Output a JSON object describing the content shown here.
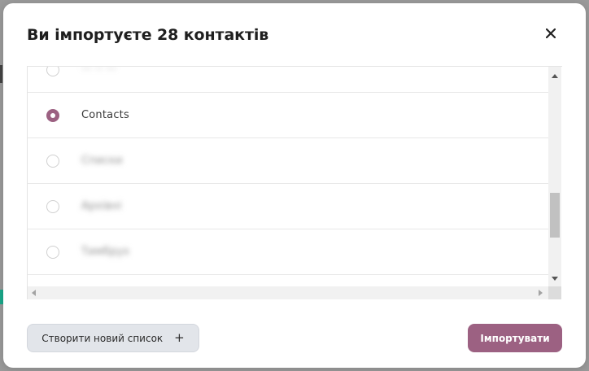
{
  "dialog": {
    "title": "Ви імпортуєте 28 контактів",
    "close_icon": "close-icon"
  },
  "lists": [
    {
      "label": "··· ·· ···",
      "selected": false,
      "blurred": true
    },
    {
      "label": "Contacts",
      "selected": true,
      "blurred": false
    },
    {
      "label": "Списки",
      "selected": false,
      "blurred": true
    },
    {
      "label": "Архівні",
      "selected": false,
      "blurred": true
    },
    {
      "label": "Тимбрух",
      "selected": false,
      "blurred": true
    },
    {
      "label": "",
      "selected": false,
      "blurred": true
    }
  ],
  "footer": {
    "new_list_label": "Створити новий список",
    "new_list_icon": "plus-icon",
    "import_label": "Імпортувати"
  },
  "colors": {
    "accent": "#9c6182",
    "secondary_button": "#e2e5ea"
  }
}
